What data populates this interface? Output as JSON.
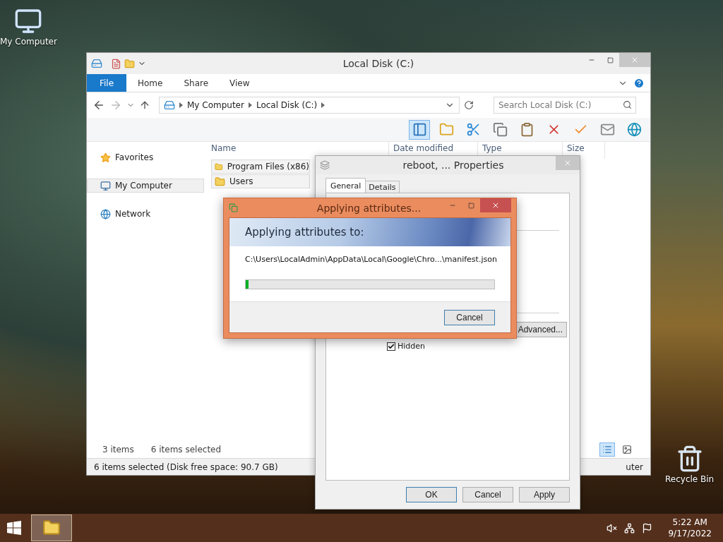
{
  "desktop_icons": [
    {
      "label": "My Computer",
      "kind": "computer"
    },
    {
      "label": "Recycle Bin",
      "kind": "recycle"
    }
  ],
  "explorer": {
    "title": "Local Disk (C:)",
    "file_button": "File",
    "ribbon_tabs": [
      "Home",
      "Share",
      "View"
    ],
    "breadcrumb": [
      "My Computer",
      "Local Disk (C:)"
    ],
    "search": {
      "placeholder": "Search Local Disk (C:)"
    },
    "nav": [
      {
        "label": "Favorites",
        "kind": "favorites",
        "selected": false
      },
      {
        "label": "My Computer",
        "kind": "computer",
        "selected": true
      },
      {
        "label": "Network",
        "kind": "network",
        "selected": false
      }
    ],
    "columns": [
      "Name",
      "Date modified",
      "Type",
      "Size"
    ],
    "rows": [
      {
        "name": "Program Files (x86)",
        "selected": true
      },
      {
        "name": "Users",
        "selected": true
      }
    ],
    "item_count": "3 items",
    "selection_count": "6 items selected",
    "status": "6 items selected (Disk free space: 90.7 GB)",
    "status_right": "uter"
  },
  "properties": {
    "title": "reboot, ... Properties",
    "tabs": [
      {
        "label": "General",
        "selected": true
      },
      {
        "label": "Details",
        "selected": false
      }
    ],
    "advanced_button": "Advanced...",
    "hidden_checkbox": {
      "label": "Hidden",
      "checked": true
    },
    "buttons": [
      "OK",
      "Cancel",
      "Apply"
    ]
  },
  "progress_dialog": {
    "title": "Applying attributes...",
    "heading": "Applying attributes to:",
    "path": "C:\\Users\\LocalAdmin\\AppData\\Local\\Google\\Chro...\\manifest.json",
    "level": 0.01,
    "button": "Cancel"
  },
  "taskbar": {
    "time": "5:22 AM",
    "date": "9/17/2022"
  }
}
